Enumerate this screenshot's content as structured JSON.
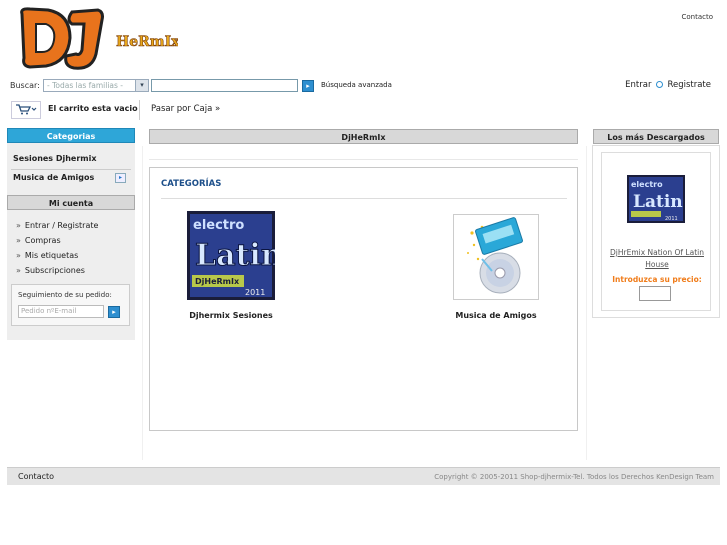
{
  "header": {
    "logo_text": "DJ HeRmIx",
    "contact_label": "Contacto"
  },
  "search": {
    "label": "Buscar:",
    "family_placeholder": "- Todas las familias -",
    "advanced_label": "Búsqueda avanzada"
  },
  "account_links": {
    "login": "Entrar",
    "register": "Registrate"
  },
  "cart": {
    "empty_text": "El carrito esta vacio",
    "checkout_label": "Pasar por Caja »"
  },
  "sidebar": {
    "categories_title": "Categorias",
    "categories": [
      {
        "label": "Sesiones Djhermix"
      },
      {
        "label": "Musica de Amigos"
      }
    ],
    "account_title": "Mi cuenta",
    "account_items": [
      {
        "label": "Entrar / Registrate"
      },
      {
        "label": "Compras"
      },
      {
        "label": "Mis etiquetas"
      },
      {
        "label": "Subscripciones"
      }
    ],
    "order_tracking": {
      "label": "Seguimiento de su pedido:",
      "placeholder": "Pedido nº",
      "email_placeholder": "E-mail"
    }
  },
  "main": {
    "header_title": "DjHeRmIx",
    "section_title": "CATEGORÍAS",
    "categories": [
      {
        "name": "Djhermix Sesiones",
        "image_text": "electro Latin DjHeRmIx 2011"
      },
      {
        "name": "Musica de Amigos"
      }
    ]
  },
  "right_panel": {
    "title": "Los más Descargados",
    "item": {
      "name": "DjHrEmix Nation Of Latin House",
      "price_label": "Introduzca su precio:",
      "image_text": "electro Latin 2011"
    }
  },
  "footer": {
    "contact_label": "Contacto",
    "copyright": "Copyright © 2005-2011 Shop-djhermix-Tel.  Todos los Derechos KenDesign Team"
  },
  "colors": {
    "accent_blue": "#2ea6d8",
    "title_blue": "#1d4f8a",
    "price_orange": "#f07c1a"
  }
}
